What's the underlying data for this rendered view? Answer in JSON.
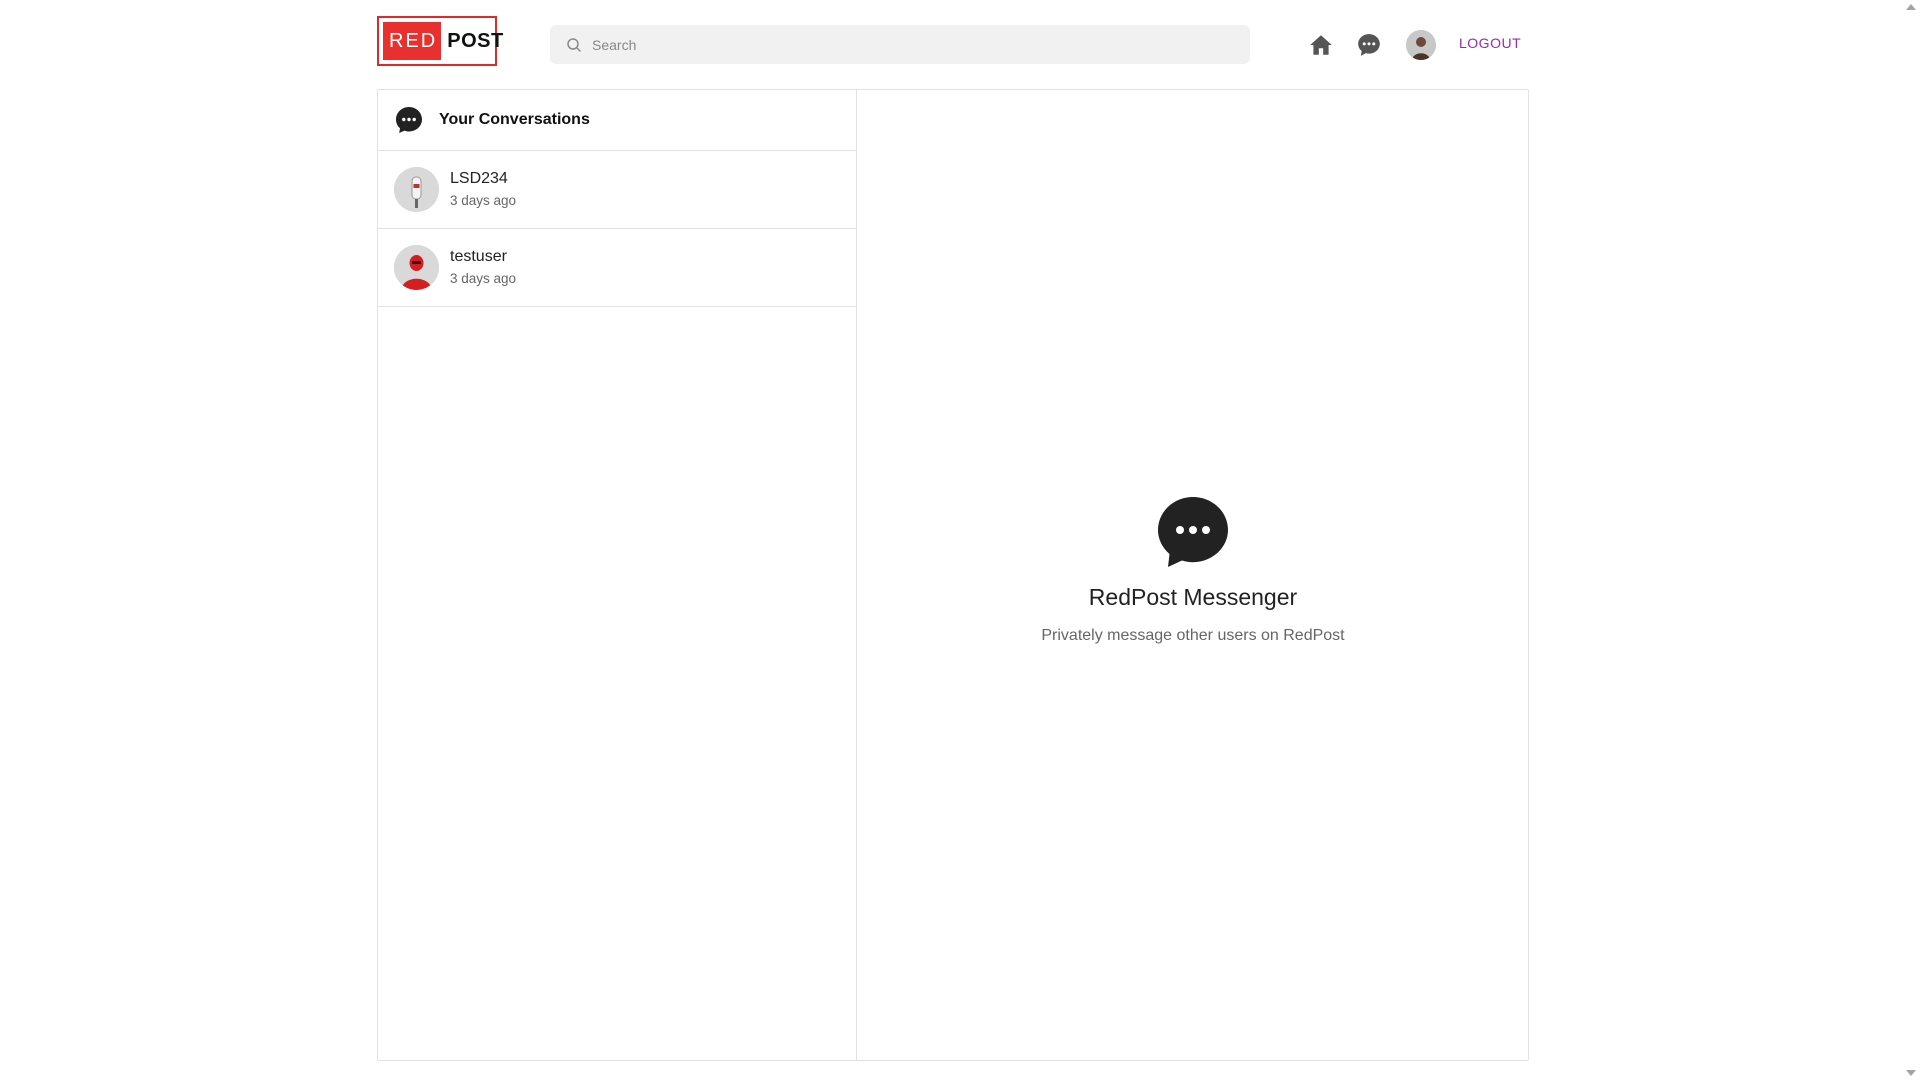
{
  "header": {
    "logo": {
      "red_text": "RED",
      "post_text": "POST"
    },
    "search": {
      "placeholder": "Search",
      "icon": "search-icon"
    },
    "nav": {
      "home_icon": "home-icon",
      "messages_icon": "chat-bubble-icon",
      "avatar": "user-avatar",
      "logout_label": "LOGOUT"
    }
  },
  "sidebar": {
    "title": "Your Conversations",
    "icon": "chat-bubble-icon",
    "conversations": [
      {
        "name": "LSD234",
        "time": "3 days ago"
      },
      {
        "name": "testuser",
        "time": "3 days ago"
      }
    ]
  },
  "main": {
    "title": "RedPost Messenger",
    "subtitle": "Privately message other users on RedPost",
    "icon": "chat-bubble-icon"
  },
  "colors": {
    "brand_red": "#e8302f",
    "logout": "#9c27b0",
    "border": "#e2e2e2",
    "search_bg": "#f1f1f1"
  }
}
